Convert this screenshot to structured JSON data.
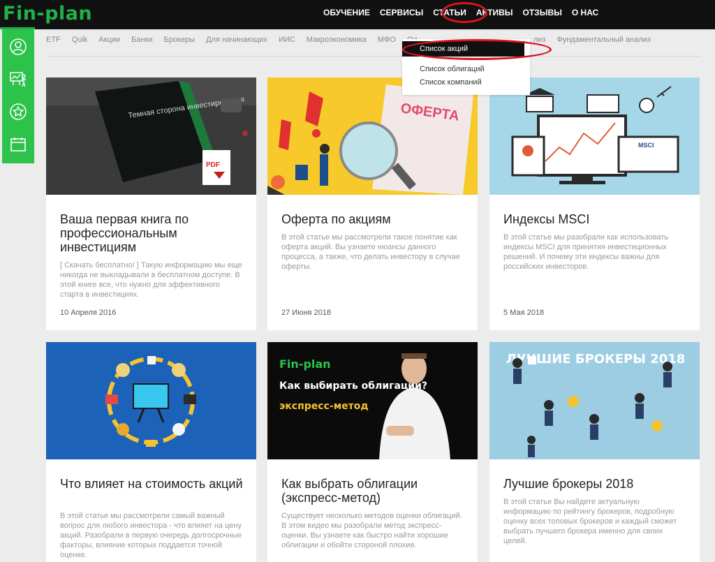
{
  "logo": "Fin-plan",
  "main_nav": [
    "ОБУЧЕНИЕ",
    "СЕРВИСЫ",
    "СТАТЬИ",
    "АКТИВЫ",
    "ОТЗЫВЫ",
    "О НАС"
  ],
  "sub_nav": [
    "ETF",
    "Quik",
    "Акции",
    "Банки",
    "Брокеры",
    "Для начинающих",
    "ИИС",
    "Макроэкономика",
    "МФО",
    "Ол",
    "лиз",
    "Фундаментальный анализ"
  ],
  "dropdown": [
    "Список акций",
    "Список облигаций",
    "Список компаний"
  ],
  "sidebar_icons": [
    "user-icon",
    "presentation-icon",
    "star-icon",
    "calendar-icon"
  ],
  "colors": {
    "brand": "#21b04b",
    "sidebar": "#2dc24a",
    "highlight": "#d8141f",
    "topbar": "#111111"
  },
  "cards": [
    {
      "title": "Ваша первая книга по профессиональным инвестициям",
      "excerpt": "[ Скачать бесплатно! ] Такую информацию мы еще никогда не выкладывали в бесплатном доступе. В этой книге все, что нужно для эффективного старта в инвестициях.",
      "date": "10 Апреля 2016",
      "image_text": "Темная сторона инвестирования",
      "badge": "PDF"
    },
    {
      "title": "Оферта по акциям",
      "excerpt": "В этой статье мы рассмотрели такое понятие как оферта акций. Вы узнаете нюансы данного процесса, а также, что делать инвестору в случае оферты.",
      "date": "27 Июня 2018",
      "image_text": "ОФЕРТА"
    },
    {
      "title": "Индексы MSCI",
      "excerpt": "В этой статье мы разобрали как использовать индексы MSCI для принятия инвестиционных решений. И почему эти индексы важны для российских инвесторов.",
      "date": "5 Мая 2018",
      "image_text": "MSCI"
    },
    {
      "title": "Что влияет на стоимость акций",
      "excerpt": "В этой статье мы рассмотрели самый важный вопрос для любого инвестора - что влияет на цену акций. Разобрали в первую очередь долгосрочные факторы, влияние которых поддается точной оценке.",
      "date": ""
    },
    {
      "title": "Как выбрать облигации (экспресс-метод)",
      "excerpt": "Существует несколько методов оценки облигаций. В этом видео мы разобрали метод экспресс-оценки. Вы узнаете как быстро найти хорошие облигации и обойти стороной плохие.",
      "date": "",
      "image_text": "Fin-plan",
      "image_text2": "Как выбирать облигации?",
      "image_text3": "экспресс-метод"
    },
    {
      "title": "Лучшие брокеры 2018",
      "excerpt": "В этой статье Вы найдете актуальную информацию по рейтингу брокеров, подробную оценку всех топовых брокеров и каждый сможет выбрать лучшего брокера именно для своих целей.",
      "date": "",
      "image_text": "ЛУЧШИЕ БРОКЕРЫ 2018"
    }
  ]
}
